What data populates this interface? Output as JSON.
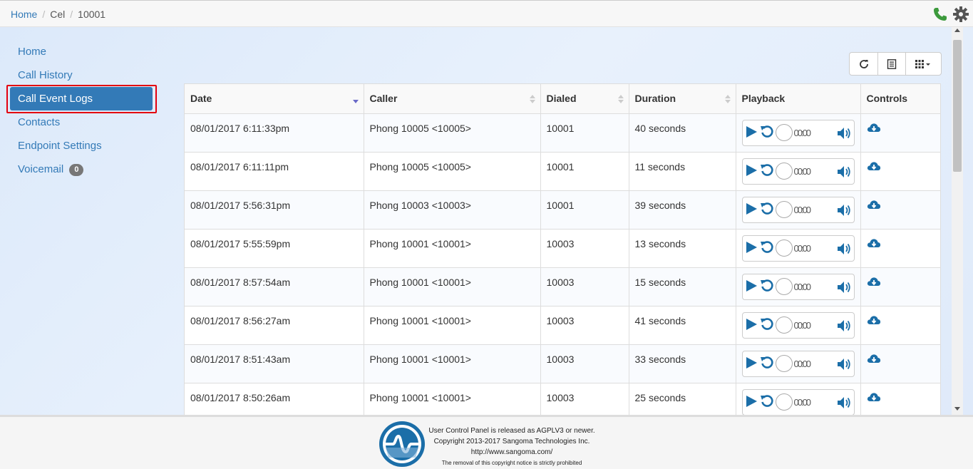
{
  "breadcrumb": [
    "Home",
    "Cel",
    "10001"
  ],
  "sidebar": {
    "items": [
      {
        "label": "Home"
      },
      {
        "label": "Call History"
      },
      {
        "label": "Call Event Logs"
      },
      {
        "label": "Contacts"
      },
      {
        "label": "Endpoint Settings"
      },
      {
        "label": "Voicemail",
        "badge": "0"
      }
    ]
  },
  "table": {
    "columns": [
      "Date",
      "Caller",
      "Dialed",
      "Duration",
      "Playback",
      "Controls"
    ],
    "rows": [
      {
        "date": "08/01/2017 6:11:33pm",
        "caller": "Phong 10005 <10005>",
        "dialed": "10001",
        "duration": "40 seconds",
        "time": "00:00"
      },
      {
        "date": "08/01/2017 6:11:11pm",
        "caller": "Phong 10005 <10005>",
        "dialed": "10001",
        "duration": "11 seconds",
        "time": "00:00"
      },
      {
        "date": "08/01/2017 5:56:31pm",
        "caller": "Phong 10003 <10003>",
        "dialed": "10001",
        "duration": "39 seconds",
        "time": "00:00"
      },
      {
        "date": "08/01/2017 5:55:59pm",
        "caller": "Phong 10001 <10001>",
        "dialed": "10003",
        "duration": "13 seconds",
        "time": "00:00"
      },
      {
        "date": "08/01/2017 8:57:54am",
        "caller": "Phong 10001 <10001>",
        "dialed": "10003",
        "duration": "15 seconds",
        "time": "00:00"
      },
      {
        "date": "08/01/2017 8:56:27am",
        "caller": "Phong 10001 <10001>",
        "dialed": "10003",
        "duration": "41 seconds",
        "time": "00:00"
      },
      {
        "date": "08/01/2017 8:51:43am",
        "caller": "Phong 10001 <10001>",
        "dialed": "10003",
        "duration": "33 seconds",
        "time": "00:00"
      },
      {
        "date": "08/01/2017 8:50:26am",
        "caller": "Phong 10001 <10001>",
        "dialed": "10003",
        "duration": "25 seconds",
        "time": "00:00"
      }
    ]
  },
  "toolbar": {
    "icons": [
      "refresh-icon",
      "list-icon",
      "grid-icon"
    ]
  },
  "footer": {
    "line1": "User Control Panel is released as AGPLV3 or newer.",
    "line2": "Copyright 2013-2017 Sangoma Technologies Inc.",
    "line3": "http://www.sangoma.com/",
    "line4": "The removal of this copyright notice is strictly prohibited"
  },
  "colors": {
    "accent": "#337ab7",
    "highlight": "#e3000f",
    "phone": "#3c9a3c",
    "player": "#1b6ea8"
  }
}
